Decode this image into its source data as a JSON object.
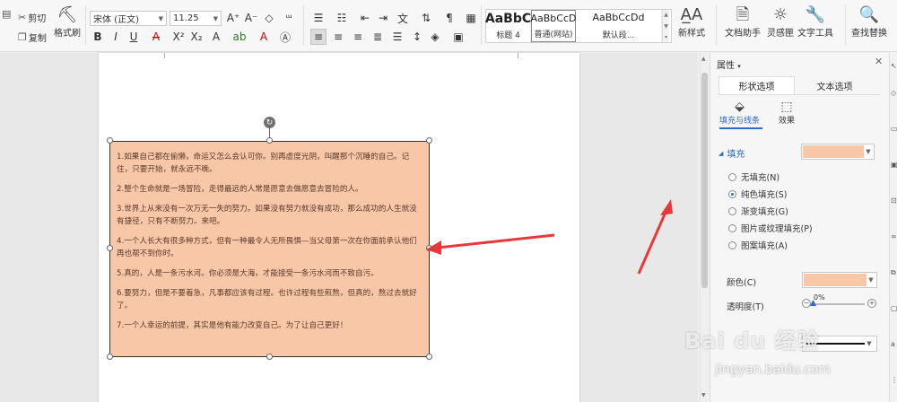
{
  "ribbon": {
    "clipboard": {
      "cut": "剪切",
      "copy": "复制",
      "format_painter": "格式刷"
    },
    "font": {
      "family": "宋体 (正文)",
      "size": "11.25"
    },
    "styles": [
      {
        "sample": "AaBbC",
        "name": "标题 4"
      },
      {
        "sample": "AaBbCcD",
        "name": "普通(网站)"
      },
      {
        "sample": "AaBbCcDd",
        "name": "默认段..."
      }
    ],
    "new_style": "新样式",
    "doc_assistant": "文档助手",
    "inspiration": "灵感匣",
    "text_tools": "文字工具",
    "find_replace": "查找替换"
  },
  "document": {
    "paragraphs": [
      "1.如果自己都在偷懒，命运又怎么会认可你。别再虚度光阴，叫醒那个沉睡的自己。记住，只要开始，就永远不晚。",
      "2.整个生命就是一场冒险，走得最远的人常是愿意去做愿意去冒险的人。",
      "3.世界上从来没有一次万无一失的努力。如果没有努力就没有成功，那么成功的人生就没有捷径，只有不断努力。来吧。",
      "4.一个人长大有很多种方式，但有一种最令人无所畏惧—当父母第一次在你面前承认他们再也帮不到你时。",
      "5.真的，人是一条污水河。你必须是大海，才能接受一条污水河而不致自污。",
      "6.要努力，但是不要着急，凡事都应该有过程。也许过程有些煎熬，但真的，熬过去就好了。",
      "7.一个人幸运的前提，其实是他有能力改变自己。为了让自己更好！"
    ]
  },
  "panel": {
    "title": "属性",
    "tabs": [
      "形状选项",
      "文本选项"
    ],
    "subtabs": [
      "填充与线条",
      "效果"
    ],
    "fill_section": "填充",
    "fill_options": [
      "无填充(N)",
      "纯色填充(S)",
      "渐变填充(G)",
      "图片或纹理填充(P)",
      "图案填充(A)"
    ],
    "selected_fill_index": 1,
    "color_label": "颜色(C)",
    "transparency_label": "透明度(T)",
    "transparency_value": "0%",
    "transparency_fraction": 0,
    "fill_color": "#f8c7a8"
  },
  "watermark": {
    "logo": "Bai du 经验",
    "url": "jingyan.baidu.com"
  }
}
